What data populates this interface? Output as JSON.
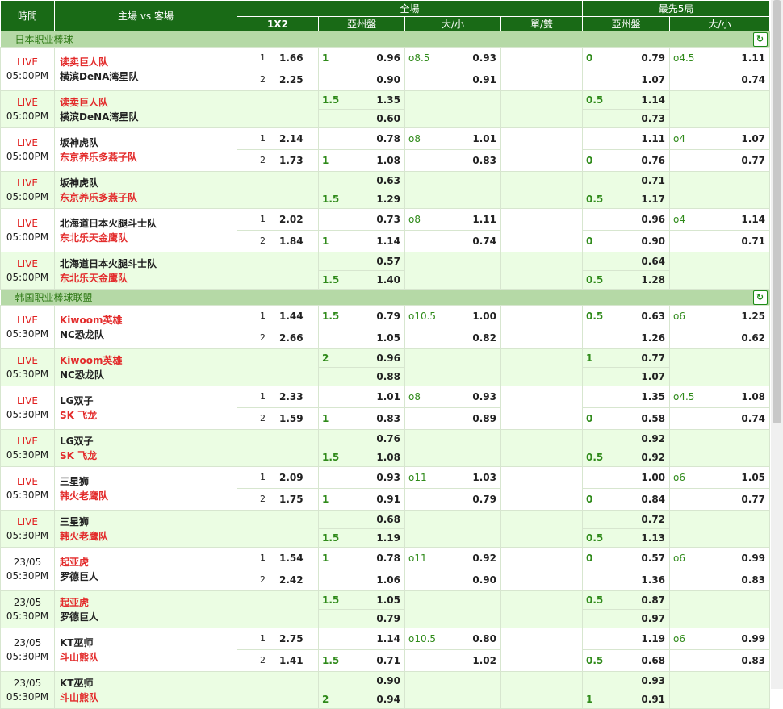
{
  "header": {
    "time": "時間",
    "teams": "主場 vs 客場",
    "full": "全場",
    "first5": "最先5局",
    "c1x2": "1X2",
    "asian": "亞州盤",
    "ou": "大/小",
    "oe": "單/雙",
    "asian2": "亞州盤",
    "ou2": "大/小"
  },
  "leagues": [
    {
      "name": "日本职业棒球",
      "matches": [
        {
          "status": "LIVE",
          "time": "05:00PM",
          "home": "读卖巨人队",
          "away": "横滨DeNA湾星队",
          "homeRed": true,
          "awayRed": false,
          "type": "main",
          "r1": {
            "x_label": "1",
            "x_val": "1.66",
            "hc_line": "1",
            "hc_val": "0.96",
            "ou_line": "o8.5",
            "ou_val": "0.93",
            "f_hc_line": "0",
            "f_hc_val": "0.79",
            "f_ou_line": "o4.5",
            "f_ou_val": "1.11"
          },
          "r2": {
            "x_label": "2",
            "x_val": "2.25",
            "hc_line": "",
            "hc_val": "0.90",
            "ou_line": "",
            "ou_val": "0.91",
            "f_hc_line": "",
            "f_hc_val": "1.07",
            "f_ou_line": "",
            "f_ou_val": "0.74"
          }
        },
        {
          "status": "LIVE",
          "time": "05:00PM",
          "home": "读卖巨人队",
          "away": "横滨DeNA湾星队",
          "homeRed": true,
          "awayRed": false,
          "type": "alt",
          "r1": {
            "hc_line": "1.5",
            "hc_val": "1.35",
            "f_hc_line": "0.5",
            "f_hc_val": "1.14"
          },
          "r2": {
            "hc_line": "",
            "hc_val": "0.60",
            "f_hc_line": "",
            "f_hc_val": "0.73"
          }
        },
        {
          "status": "LIVE",
          "time": "05:00PM",
          "home": "坂神虎队",
          "away": "东京养乐多燕子队",
          "homeRed": false,
          "awayRed": true,
          "type": "main",
          "r1": {
            "x_label": "1",
            "x_val": "2.14",
            "hc_line": "",
            "hc_val": "0.78",
            "ou_line": "o8",
            "ou_val": "1.01",
            "f_hc_line": "",
            "f_hc_val": "1.11",
            "f_ou_line": "o4",
            "f_ou_val": "1.07"
          },
          "r2": {
            "x_label": "2",
            "x_val": "1.73",
            "hc_line": "1",
            "hc_val": "1.08",
            "ou_line": "",
            "ou_val": "0.83",
            "f_hc_line": "0",
            "f_hc_val": "0.76",
            "f_ou_line": "",
            "f_ou_val": "0.77"
          }
        },
        {
          "status": "LIVE",
          "time": "05:00PM",
          "home": "坂神虎队",
          "away": "东京养乐多燕子队",
          "homeRed": false,
          "awayRed": true,
          "type": "alt",
          "r1": {
            "hc_line": "",
            "hc_val": "0.63",
            "f_hc_line": "",
            "f_hc_val": "0.71"
          },
          "r2": {
            "hc_line": "1.5",
            "hc_val": "1.29",
            "f_hc_line": "0.5",
            "f_hc_val": "1.17"
          }
        },
        {
          "status": "LIVE",
          "time": "05:00PM",
          "home": "北海道日本火腿斗士队",
          "away": "东北乐天金鹰队",
          "homeRed": false,
          "awayRed": true,
          "type": "main",
          "r1": {
            "x_label": "1",
            "x_val": "2.02",
            "hc_line": "",
            "hc_val": "0.73",
            "ou_line": "o8",
            "ou_val": "1.11",
            "f_hc_line": "",
            "f_hc_val": "0.96",
            "f_ou_line": "o4",
            "f_ou_val": "1.14"
          },
          "r2": {
            "x_label": "2",
            "x_val": "1.84",
            "hc_line": "1",
            "hc_val": "1.14",
            "ou_line": "",
            "ou_val": "0.74",
            "f_hc_line": "0",
            "f_hc_val": "0.90",
            "f_ou_line": "",
            "f_ou_val": "0.71"
          }
        },
        {
          "status": "LIVE",
          "time": "05:00PM",
          "home": "北海道日本火腿斗士队",
          "away": "东北乐天金鹰队",
          "homeRed": false,
          "awayRed": true,
          "type": "alt",
          "r1": {
            "hc_line": "",
            "hc_val": "0.57",
            "f_hc_line": "",
            "f_hc_val": "0.64"
          },
          "r2": {
            "hc_line": "1.5",
            "hc_val": "1.40",
            "f_hc_line": "0.5",
            "f_hc_val": "1.28"
          }
        }
      ]
    },
    {
      "name": "韩国职业棒球联盟",
      "matches": [
        {
          "status": "LIVE",
          "time": "05:30PM",
          "home": "Kiwoom英雄",
          "away": "NC恐龙队",
          "homeRed": true,
          "awayRed": false,
          "type": "main",
          "r1": {
            "x_label": "1",
            "x_val": "1.44",
            "hc_line": "1.5",
            "hc_val": "0.79",
            "ou_line": "o10.5",
            "ou_val": "1.00",
            "f_hc_line": "0.5",
            "f_hc_val": "0.63",
            "f_ou_line": "o6",
            "f_ou_val": "1.25"
          },
          "r2": {
            "x_label": "2",
            "x_val": "2.66",
            "hc_line": "",
            "hc_val": "1.05",
            "ou_line": "",
            "ou_val": "0.82",
            "f_hc_line": "",
            "f_hc_val": "1.26",
            "f_ou_line": "",
            "f_ou_val": "0.62"
          }
        },
        {
          "status": "LIVE",
          "time": "05:30PM",
          "home": "Kiwoom英雄",
          "away": "NC恐龙队",
          "homeRed": true,
          "awayRed": false,
          "type": "alt",
          "r1": {
            "hc_line": "2",
            "hc_val": "0.96",
            "f_hc_line": "1",
            "f_hc_val": "0.77"
          },
          "r2": {
            "hc_line": "",
            "hc_val": "0.88",
            "f_hc_line": "",
            "f_hc_val": "1.07"
          }
        },
        {
          "status": "LIVE",
          "time": "05:30PM",
          "home": "LG双子",
          "away": "SK 飞龙",
          "homeRed": false,
          "awayRed": true,
          "type": "main",
          "r1": {
            "x_label": "1",
            "x_val": "2.33",
            "hc_line": "",
            "hc_val": "1.01",
            "ou_line": "o8",
            "ou_val": "0.93",
            "f_hc_line": "",
            "f_hc_val": "1.35",
            "f_ou_line": "o4.5",
            "f_ou_val": "1.08"
          },
          "r2": {
            "x_label": "2",
            "x_val": "1.59",
            "hc_line": "1",
            "hc_val": "0.83",
            "ou_line": "",
            "ou_val": "0.89",
            "f_hc_line": "0",
            "f_hc_val": "0.58",
            "f_ou_line": "",
            "f_ou_val": "0.74"
          }
        },
        {
          "status": "LIVE",
          "time": "05:30PM",
          "home": "LG双子",
          "away": "SK 飞龙",
          "homeRed": false,
          "awayRed": true,
          "type": "alt",
          "r1": {
            "hc_line": "",
            "hc_val": "0.76",
            "f_hc_line": "",
            "f_hc_val": "0.92"
          },
          "r2": {
            "hc_line": "1.5",
            "hc_val": "1.08",
            "f_hc_line": "0.5",
            "f_hc_val": "0.92"
          }
        },
        {
          "status": "LIVE",
          "time": "05:30PM",
          "home": "三星狮",
          "away": "韩火老鹰队",
          "homeRed": false,
          "awayRed": true,
          "type": "main",
          "r1": {
            "x_label": "1",
            "x_val": "2.09",
            "hc_line": "",
            "hc_val": "0.93",
            "ou_line": "o11",
            "ou_val": "1.03",
            "f_hc_line": "",
            "f_hc_val": "1.00",
            "f_ou_line": "o6",
            "f_ou_val": "1.05"
          },
          "r2": {
            "x_label": "2",
            "x_val": "1.75",
            "hc_line": "1",
            "hc_val": "0.91",
            "ou_line": "",
            "ou_val": "0.79",
            "f_hc_line": "0",
            "f_hc_val": "0.84",
            "f_ou_line": "",
            "f_ou_val": "0.77"
          }
        },
        {
          "status": "LIVE",
          "time": "05:30PM",
          "home": "三星狮",
          "away": "韩火老鹰队",
          "homeRed": false,
          "awayRed": true,
          "type": "alt",
          "r1": {
            "hc_line": "",
            "hc_val": "0.68",
            "f_hc_line": "",
            "f_hc_val": "0.72"
          },
          "r2": {
            "hc_line": "1.5",
            "hc_val": "1.19",
            "f_hc_line": "0.5",
            "f_hc_val": "1.13"
          }
        },
        {
          "status": "23/05",
          "time": "05:30PM",
          "home": "起亚虎",
          "away": "罗德巨人",
          "homeRed": true,
          "awayRed": false,
          "type": "main",
          "r1": {
            "x_label": "1",
            "x_val": "1.54",
            "hc_line": "1",
            "hc_val": "0.78",
            "ou_line": "o11",
            "ou_val": "0.92",
            "f_hc_line": "0",
            "f_hc_val": "0.57",
            "f_ou_line": "o6",
            "f_ou_val": "0.99"
          },
          "r2": {
            "x_label": "2",
            "x_val": "2.42",
            "hc_line": "",
            "hc_val": "1.06",
            "ou_line": "",
            "ou_val": "0.90",
            "f_hc_line": "",
            "f_hc_val": "1.36",
            "f_ou_line": "",
            "f_ou_val": "0.83"
          }
        },
        {
          "status": "23/05",
          "time": "05:30PM",
          "home": "起亚虎",
          "away": "罗德巨人",
          "homeRed": true,
          "awayRed": false,
          "type": "alt",
          "r1": {
            "hc_line": "1.5",
            "hc_val": "1.05",
            "f_hc_line": "0.5",
            "f_hc_val": "0.87"
          },
          "r2": {
            "hc_line": "",
            "hc_val": "0.79",
            "f_hc_line": "",
            "f_hc_val": "0.97"
          }
        },
        {
          "status": "23/05",
          "time": "05:30PM",
          "home": "KT巫师",
          "away": "斗山熊队",
          "homeRed": false,
          "awayRed": true,
          "type": "main",
          "r1": {
            "x_label": "1",
            "x_val": "2.75",
            "hc_line": "",
            "hc_val": "1.14",
            "ou_line": "o10.5",
            "ou_val": "0.80",
            "f_hc_line": "",
            "f_hc_val": "1.19",
            "f_ou_line": "o6",
            "f_ou_val": "0.99"
          },
          "r2": {
            "x_label": "2",
            "x_val": "1.41",
            "hc_line": "1.5",
            "hc_val": "0.71",
            "ou_line": "",
            "ou_val": "1.02",
            "f_hc_line": "0.5",
            "f_hc_val": "0.68",
            "f_ou_line": "",
            "f_ou_val": "0.83"
          }
        },
        {
          "status": "23/05",
          "time": "05:30PM",
          "home": "KT巫师",
          "away": "斗山熊队",
          "homeRed": false,
          "awayRed": true,
          "type": "alt",
          "r1": {
            "hc_line": "",
            "hc_val": "0.90",
            "f_hc_line": "",
            "f_hc_val": "0.93"
          },
          "r2": {
            "hc_line": "2",
            "hc_val": "0.94",
            "f_hc_line": "1",
            "f_hc_val": "0.91"
          }
        }
      ]
    }
  ]
}
